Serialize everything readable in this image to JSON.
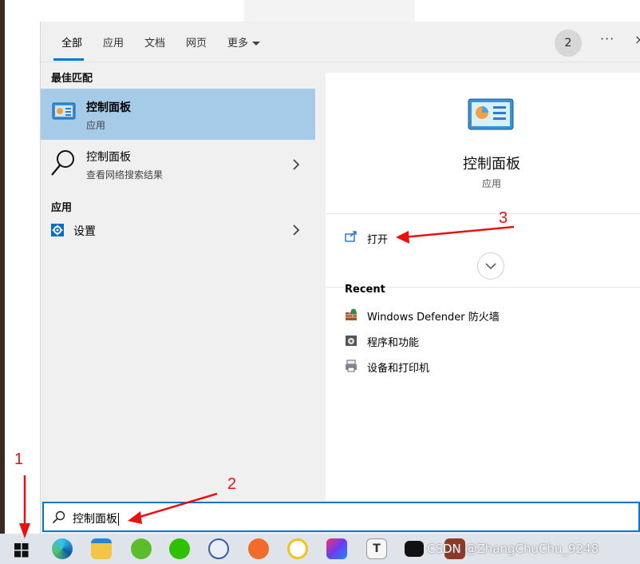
{
  "tabs": [
    {
      "label": "全部"
    },
    {
      "label": "应用"
    },
    {
      "label": "文档"
    },
    {
      "label": "网页"
    },
    {
      "label": "更多"
    }
  ],
  "header": {
    "badge": "2",
    "more_dots": "···",
    "close": "×"
  },
  "left": {
    "best_match_heading": "最佳匹配",
    "best_match": {
      "title": "控制面板",
      "subtitle": "应用"
    },
    "web_result": {
      "title": "控制面板",
      "subtitle": "查看网络搜索结果"
    },
    "apps_heading": "应用",
    "app_item": {
      "title": "设置"
    }
  },
  "right": {
    "app_name": "控制面板",
    "app_type": "应用",
    "open_label": "打开",
    "recent_heading": "Recent",
    "recent": [
      {
        "label": "Windows Defender 防火墙"
      },
      {
        "label": "程序和功能"
      },
      {
        "label": "设备和打印机"
      }
    ]
  },
  "search": {
    "value": "控制面板"
  },
  "watermark": "CSDN @ZhangChuChu_9248",
  "annotations": {
    "one": "1",
    "two": "2",
    "three": "3"
  },
  "colors": {
    "accent": "#0078d4",
    "selected": "#a6cbe8",
    "annotation": "#e81010"
  }
}
